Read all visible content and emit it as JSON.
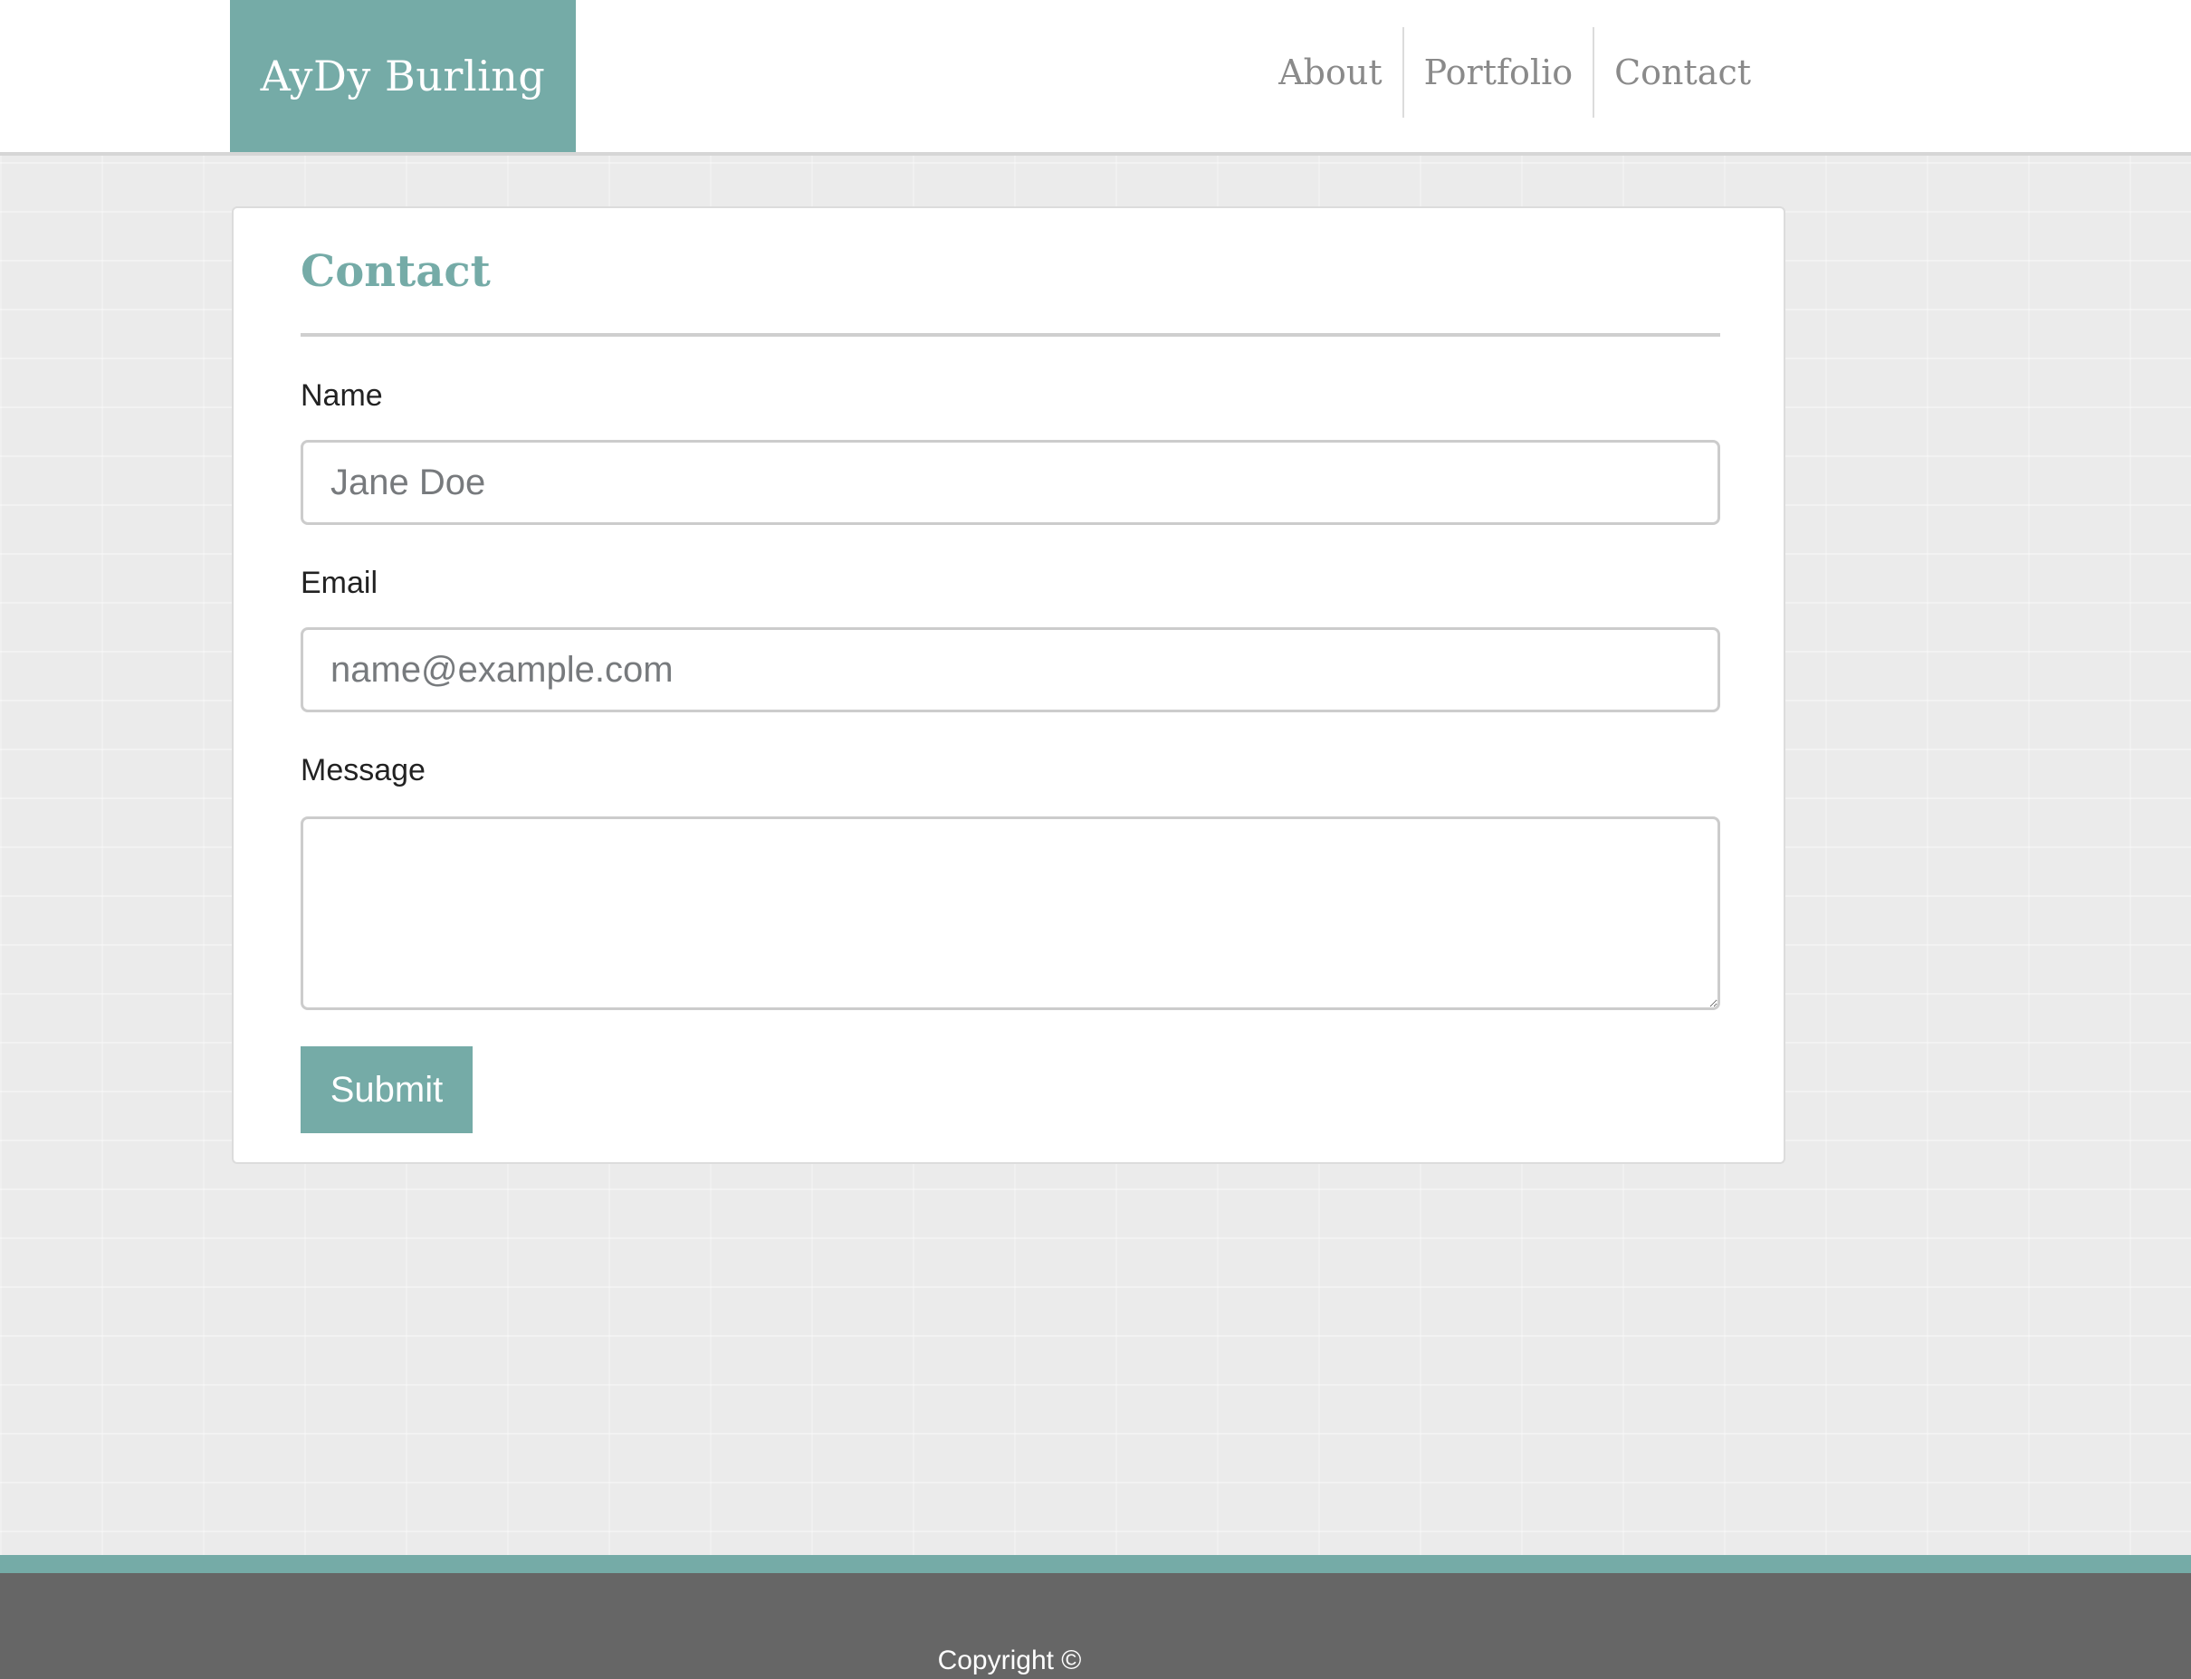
{
  "header": {
    "brand": "AyDy Burling",
    "nav": [
      {
        "label": "About"
      },
      {
        "label": "Portfolio"
      },
      {
        "label": "Contact"
      }
    ]
  },
  "contact_form": {
    "title": "Contact",
    "name": {
      "label": "Name",
      "placeholder": "Jane Doe",
      "value": ""
    },
    "email": {
      "label": "Email",
      "placeholder": "name@example.com",
      "value": ""
    },
    "message": {
      "label": "Message",
      "placeholder": "",
      "value": ""
    },
    "submit_label": "Submit"
  },
  "footer": {
    "copyright": "Copyright ©"
  },
  "colors": {
    "accent": "#75aba7",
    "footer_bg": "#666666",
    "page_bg": "#ebebeb"
  }
}
